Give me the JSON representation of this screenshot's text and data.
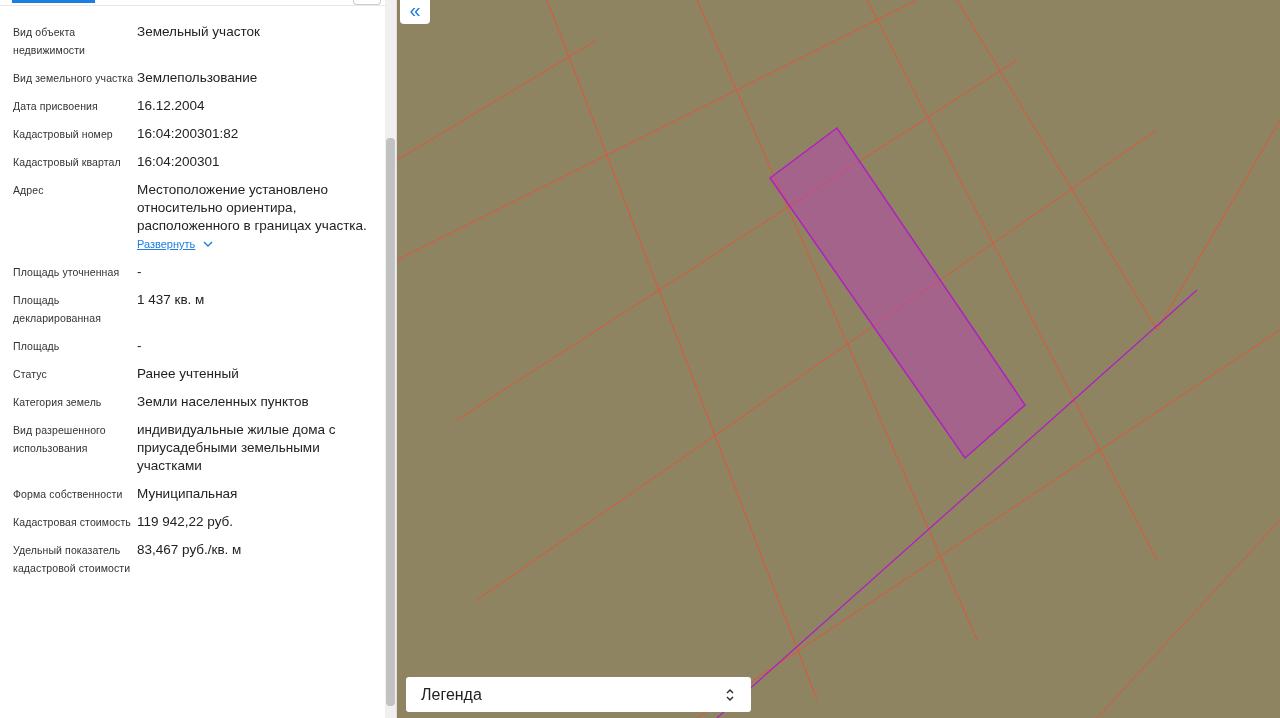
{
  "panel": {
    "fields": [
      {
        "label": "Вид объекта недвижимости",
        "value": "Земельный участок"
      },
      {
        "label": "Вид земельного участка",
        "value": "Землепользование"
      },
      {
        "label": "Дата присвоения",
        "value": "16.12.2004"
      },
      {
        "label": "Кадастровый номер",
        "value": "16:04:200301:82"
      },
      {
        "label": "Кадастровый квартал",
        "value": "16:04:200301"
      },
      {
        "label": "Адрес",
        "value": "Местоположение установлено относительно ориентира, расположенного в границах участка.",
        "expand_link": "Развернуть"
      },
      {
        "label": "Площадь уточненная",
        "value": "-"
      },
      {
        "label": "Площадь декларированная",
        "value": "1 437 кв. м"
      },
      {
        "label": "Площадь",
        "value": "-"
      },
      {
        "label": "Статус",
        "value": "Ранее учтенный"
      },
      {
        "label": "Категория земель",
        "value": "Земли населенных пунктов"
      },
      {
        "label": "Вид разрешенного использования",
        "value": "индивидуальные жилые дома с приусадебными земельными участками"
      },
      {
        "label": "Форма собственности",
        "value": "Муниципальная"
      },
      {
        "label": "Кадастровая стоимость",
        "value": "119 942,22 руб."
      },
      {
        "label": "Удельный показатель кадастровой стоимости",
        "value": "83,467 руб./кв. м"
      }
    ]
  },
  "map": {
    "collapse_button": "«",
    "legend": {
      "label": "Легенда"
    }
  }
}
